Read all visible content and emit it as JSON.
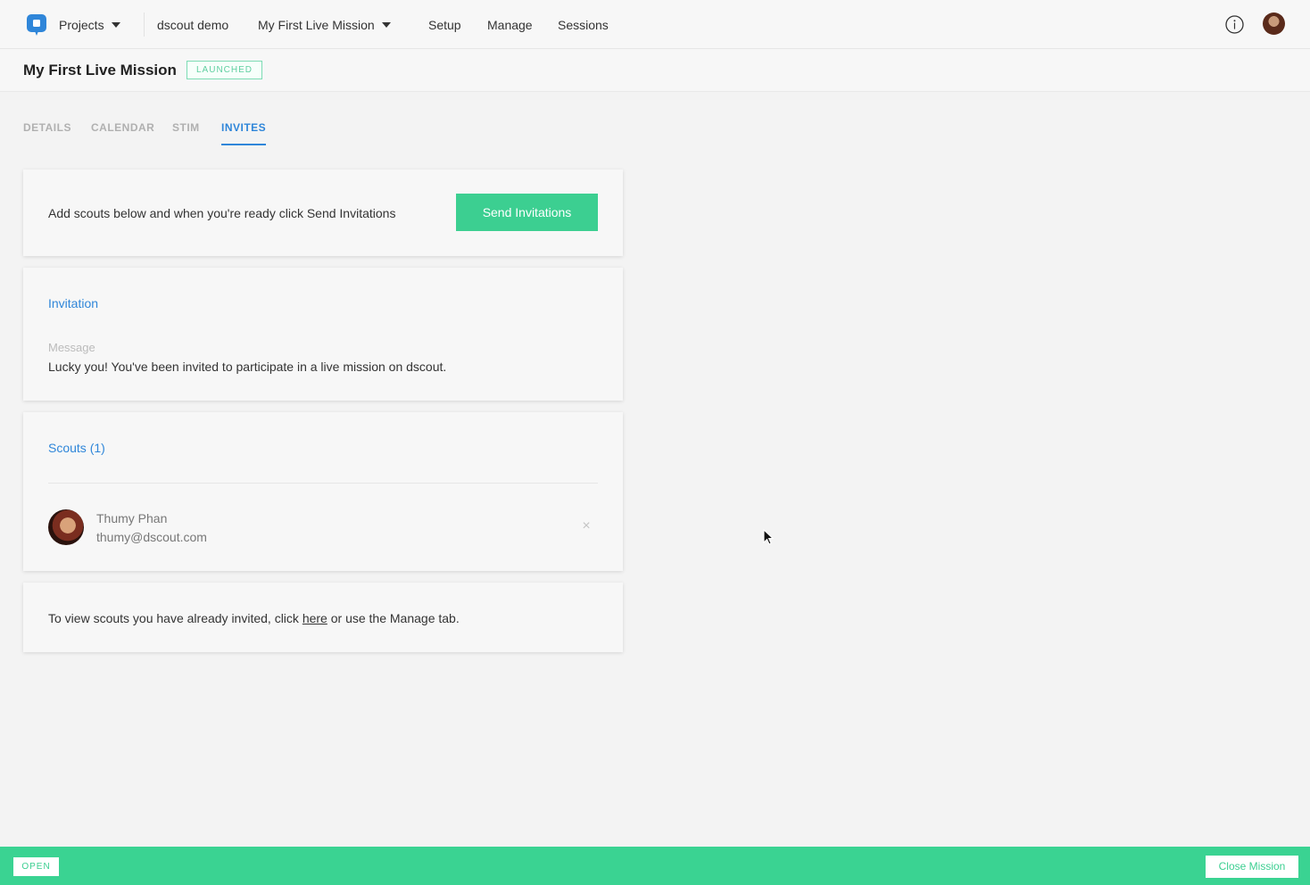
{
  "topnav": {
    "projects_label": "Projects",
    "workspace_label": "dscout demo",
    "mission_label": "My First Live Mission",
    "setup_label": "Setup",
    "manage_label": "Manage",
    "sessions_label": "Sessions"
  },
  "mission": {
    "title": "My First Live Mission",
    "status": "LAUNCHED"
  },
  "tabs": [
    {
      "label": "DETAILS"
    },
    {
      "label": "CALENDAR"
    },
    {
      "label": "STIM"
    },
    {
      "label": "INVITES",
      "active": true
    }
  ],
  "invite_card": {
    "instruction": "Add scouts below and when you're ready click Send Invitations",
    "send_button": "Send Invitations"
  },
  "invitation": {
    "title": "Invitation",
    "message_label": "Message",
    "message": "Lucky you! You've been invited to participate in a live mission on dscout."
  },
  "scouts": {
    "title": "Scouts (1)",
    "items": [
      {
        "name": "Thumy Phan",
        "email": "thumy@dscout.com"
      }
    ],
    "remove_glyph": "×"
  },
  "view_note": {
    "before": "To view scouts you have already invited, click ",
    "link": "here",
    "after": " or use the Manage tab."
  },
  "footer": {
    "status": "OPEN",
    "close_button": "Close Mission"
  },
  "colors": {
    "accent_blue": "#2f86d9",
    "accent_green": "#3ccf91"
  }
}
